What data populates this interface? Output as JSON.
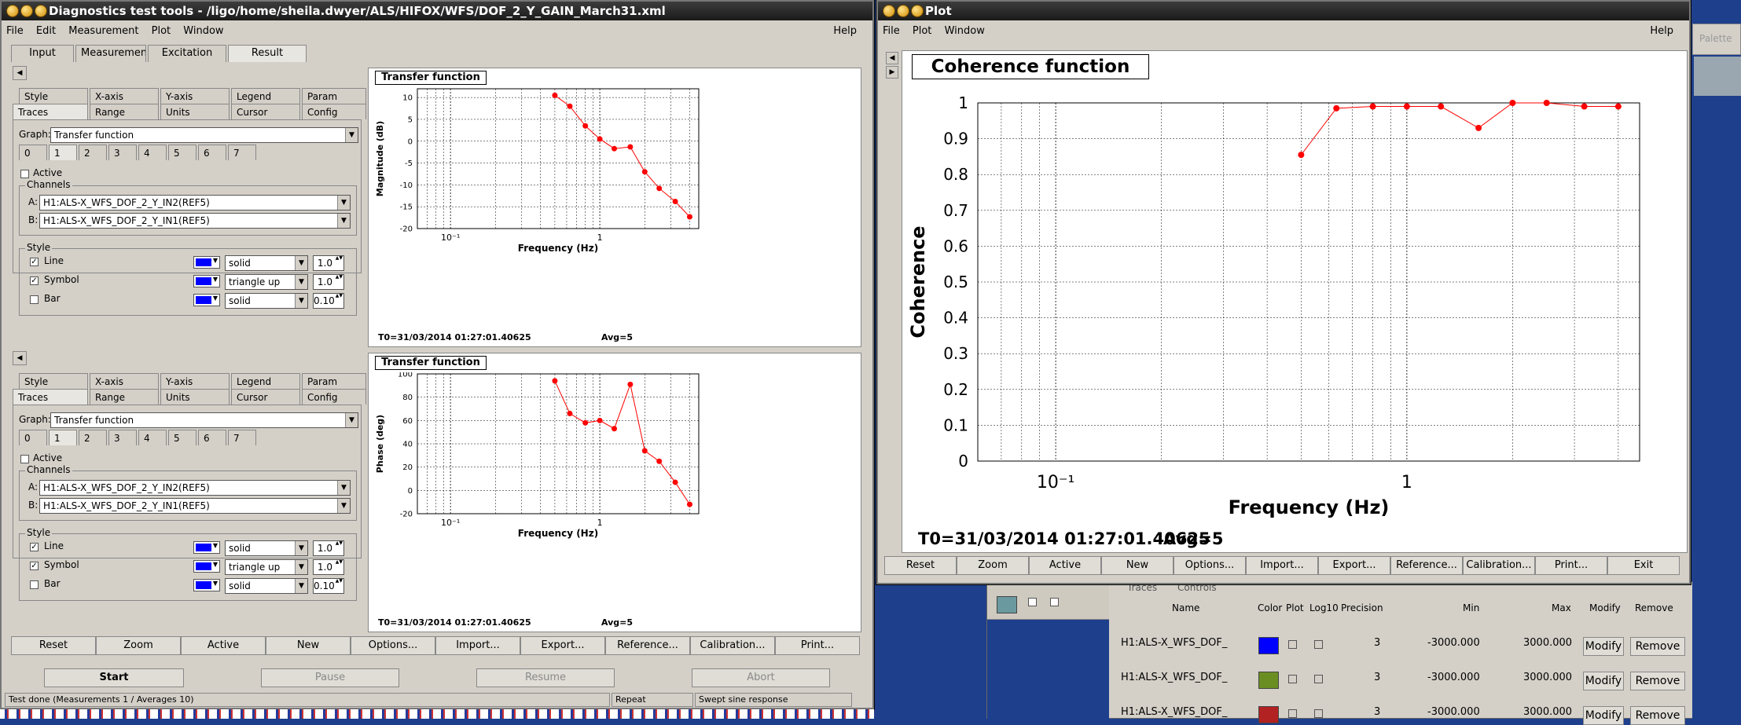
{
  "left_window": {
    "title": "Diagnostics test tools - /ligo/home/sheila.dwyer/ALS/HIFOX/WFS/DOF_2_Y_GAIN_March31.xml",
    "menu": [
      "File",
      "Edit",
      "Measurement",
      "Plot",
      "Window"
    ],
    "help": "Help",
    "main_tabs": [
      "Input",
      "Measurement",
      "Excitation",
      "Result"
    ],
    "option_tabs_row1": [
      "Style",
      "X-axis",
      "Y-axis",
      "Legend",
      "Param"
    ],
    "option_tabs_row2": [
      "Traces",
      "Range",
      "Units",
      "Cursor",
      "Config"
    ],
    "graph_label": "Graph:",
    "graph_value": "Transfer function",
    "trace_tabs": [
      "0",
      "1",
      "2",
      "3",
      "4",
      "5",
      "6",
      "7"
    ],
    "active_label": "Active",
    "channels_label": "Channels",
    "channel_a_label": "A:",
    "channel_a": "H1:ALS-X_WFS_DOF_2_Y_IN2(REF5)",
    "channel_b_label": "B:",
    "channel_b": "H1:ALS-X_WFS_DOF_2_Y_IN1(REF5)",
    "style_label": "Style",
    "style_rows": [
      {
        "name": "Line",
        "checked": true,
        "type": "solid",
        "width": "1.0"
      },
      {
        "name": "Symbol",
        "checked": true,
        "type": "triangle up",
        "width": "1.0"
      },
      {
        "name": "Bar",
        "checked": false,
        "type": "solid",
        "width": "0.10"
      }
    ],
    "plot_buttons": [
      "Reset",
      "Zoom",
      "Active",
      "New",
      "Options...",
      "Import...",
      "Export...",
      "Reference...",
      "Calibration...",
      "Print..."
    ],
    "run_buttons": [
      "Start",
      "Pause",
      "Resume",
      "Abort"
    ],
    "status": [
      "Test done (Measurements 1 / Averages 10)",
      "Repeat",
      "Swept sine response"
    ],
    "plot_footer_t0": "T0=31/03/2014 01:27:01.40625",
    "plot_footer_avg": "Avg=5"
  },
  "magnitude_plot": {
    "title": "Transfer function",
    "ylabel": "Magnitude (dB)",
    "xlabel": "Frequency (Hz)",
    "yticks": [
      "10",
      "5",
      "0",
      "-5",
      "-10",
      "-15",
      "-20"
    ],
    "xticks": [
      "10⁻¹",
      "1"
    ]
  },
  "phase_plot": {
    "title": "Transfer function",
    "ylabel": "Phase (deg)",
    "xlabel": "Frequency (Hz)",
    "yticks": [
      "100",
      "80",
      "60",
      "40",
      "20",
      "0",
      "-20"
    ],
    "xticks": [
      "10⁻¹",
      "1"
    ]
  },
  "coherence_window": {
    "title": "Plot",
    "menu": [
      "File",
      "Plot",
      "Window"
    ],
    "help": "Help",
    "plot_title": "Coherence function",
    "ylabel": "Coherence",
    "xlabel": "Frequency (Hz)",
    "yticks": [
      "1",
      "0.9",
      "0.8",
      "0.7",
      "0.6",
      "0.5",
      "0.4",
      "0.3",
      "0.2",
      "0.1",
      "0"
    ],
    "xticks": [
      "10⁻¹",
      "1"
    ],
    "footer_t0": "T0=31/03/2014 01:27:01.40625",
    "footer_avg": "Avg=5",
    "buttons": [
      "Reset",
      "Zoom",
      "Active",
      "New",
      "Options...",
      "Import...",
      "Export...",
      "Reference...",
      "Calibration...",
      "Print...",
      "Exit"
    ]
  },
  "bg_window": {
    "palette_label": "Palette",
    "tabs": [
      "Traces",
      "Controls"
    ],
    "columns": [
      "Name",
      "Color",
      "Plot",
      "Log10",
      "Precision",
      "Min",
      "Max",
      "Modify",
      "Remove"
    ],
    "rows": [
      {
        "name": "H1:ALS-X_WFS_DOF_",
        "color": "#0000ff",
        "precision": "3",
        "min": "-3000.000",
        "max": "3000.000",
        "modify": "Modify",
        "remove": "Remove"
      },
      {
        "name": "H1:ALS-X_WFS_DOF_",
        "color": "#6b8e23",
        "precision": "3",
        "min": "-3000.000",
        "max": "3000.000",
        "modify": "Modify",
        "remove": "Remove"
      },
      {
        "name": "H1:ALS-X_WFS_DOF_",
        "color": "#b22222",
        "precision": "3",
        "min": "-3000.000",
        "max": "3000.000",
        "modify": "Modify",
        "remove": "Remove"
      }
    ]
  },
  "chart_data": [
    {
      "type": "line",
      "title": "Transfer function",
      "xlabel": "Frequency (Hz)",
      "ylabel": "Magnitude (dB)",
      "xscale": "log",
      "xlim": [
        0.06,
        0.75
      ],
      "ylim": [
        -20,
        12
      ],
      "x": [
        0.5,
        0.63,
        0.8,
        1.0,
        1.25,
        1.6,
        2.0,
        2.5,
        3.2,
        4.0
      ],
      "y": [
        10.5,
        8.0,
        3.5,
        0.5,
        -1.7,
        -1.3,
        -7.0,
        -10.8,
        -13.8,
        -17.3
      ],
      "color": "#ff0000"
    },
    {
      "type": "line",
      "title": "Transfer function",
      "xlabel": "Frequency (Hz)",
      "ylabel": "Phase (deg)",
      "xscale": "log",
      "xlim": [
        0.06,
        0.75
      ],
      "ylim": [
        -20,
        100
      ],
      "x": [
        0.5,
        0.63,
        0.8,
        1.0,
        1.25,
        1.6,
        2.0,
        2.5,
        3.2,
        4.0
      ],
      "y": [
        94,
        66,
        58,
        60,
        53,
        91,
        34,
        25,
        7,
        -12
      ],
      "color": "#ff0000"
    },
    {
      "type": "line",
      "title": "Coherence function",
      "xlabel": "Frequency (Hz)",
      "ylabel": "Coherence",
      "xscale": "log",
      "xlim": [
        0.06,
        0.75
      ],
      "ylim": [
        0,
        1
      ],
      "x": [
        0.5,
        0.63,
        0.8,
        1.0,
        1.25,
        1.6,
        2.0,
        2.5,
        3.2,
        4.0
      ],
      "y": [
        0.855,
        0.985,
        0.99,
        0.99,
        0.99,
        0.93,
        1.0,
        1.0,
        0.99,
        0.99
      ],
      "color": "#ff0000"
    }
  ]
}
